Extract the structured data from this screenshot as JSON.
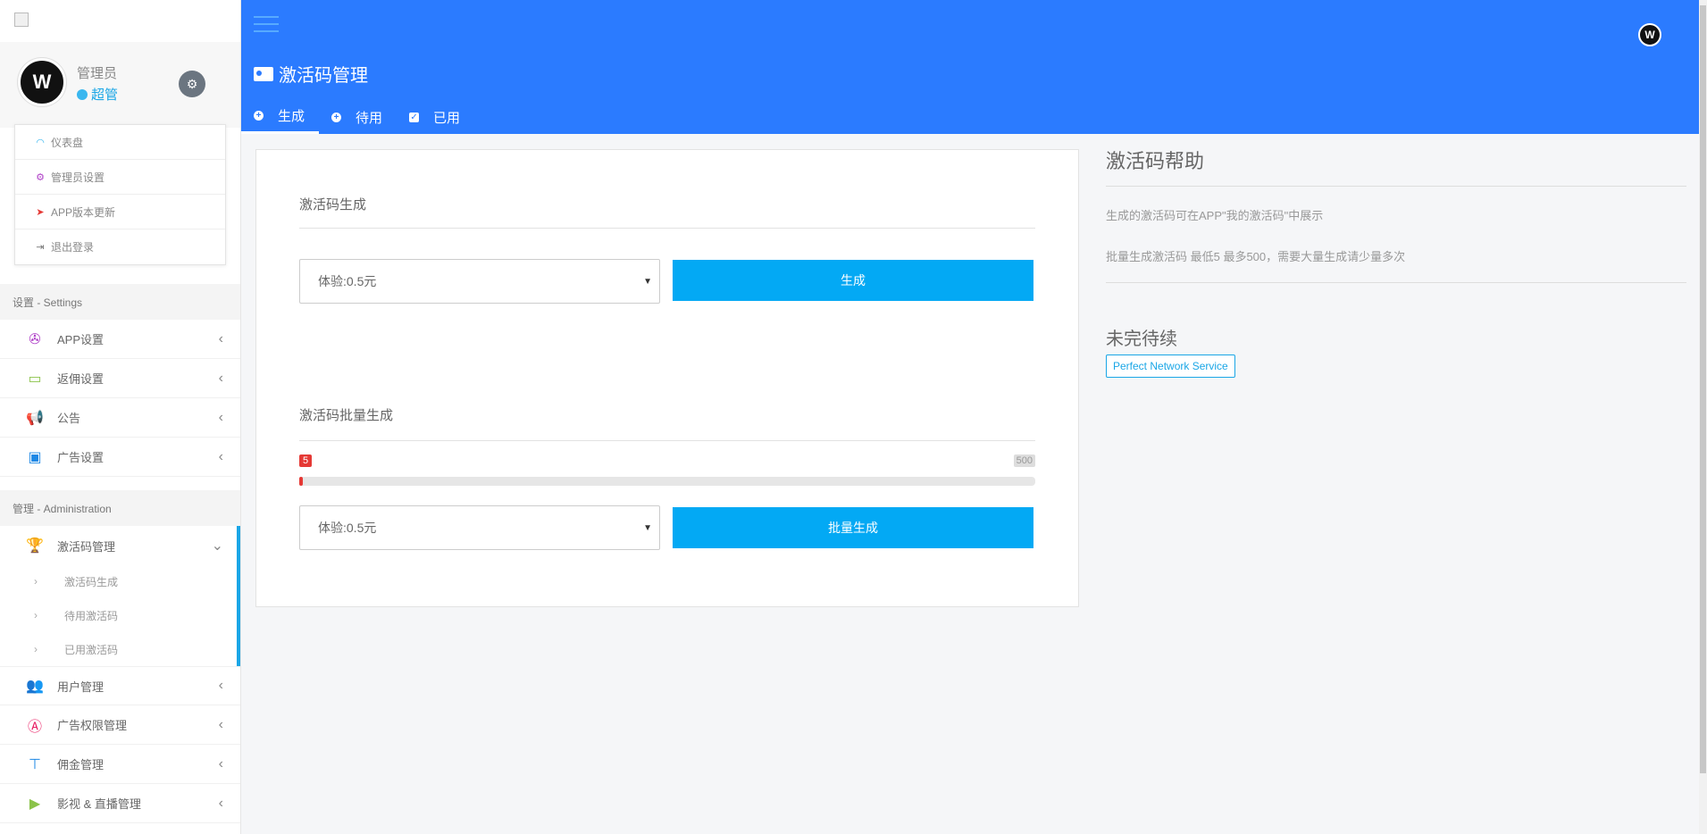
{
  "header": {
    "page_title": "激活码管理",
    "tabs": [
      {
        "label": "生成",
        "icon": "plus-circle-icon",
        "active": true
      },
      {
        "label": "待用",
        "icon": "plus-circle-icon",
        "active": false
      },
      {
        "label": "已用",
        "icon": "check-square-icon",
        "active": false
      }
    ],
    "accent_color": "#2b7bff"
  },
  "profile": {
    "name": "管理员",
    "role": "超管"
  },
  "user_menu": [
    {
      "label": "仪表盘",
      "icon": "dashboard-icon"
    },
    {
      "label": "管理员设置",
      "icon": "gears-icon"
    },
    {
      "label": "APP版本更新",
      "icon": "paper-plane-icon"
    },
    {
      "label": "退出登录",
      "icon": "sign-out-icon"
    }
  ],
  "sidebar": {
    "settings_header": "设置 - Settings",
    "settings_items": [
      {
        "label": "APP设置",
        "icon": "android-icon"
      },
      {
        "label": "返佣设置",
        "icon": "credit-card-icon"
      },
      {
        "label": "公告",
        "icon": "bullhorn-icon"
      },
      {
        "label": "广告设置",
        "icon": "image-icon"
      }
    ],
    "admin_header": "管理 - Administration",
    "admin_active": {
      "label": "激活码管理",
      "icon": "trophy-icon"
    },
    "admin_subitems": [
      {
        "label": "激活码生成"
      },
      {
        "label": "待用激活码"
      },
      {
        "label": "已用激活码"
      }
    ],
    "admin_items": [
      {
        "label": "用户管理",
        "icon": "users-icon"
      },
      {
        "label": "广告权限管理",
        "icon": "angular-icon"
      },
      {
        "label": "佣金管理",
        "icon": "sitemap-icon"
      },
      {
        "label": "影视 & 直播管理",
        "icon": "play-icon"
      }
    ]
  },
  "generate": {
    "section_title": "激活码生成",
    "select_value": "体验:0.5元",
    "button_label": "生成"
  },
  "batch": {
    "section_title": "激活码批量生成",
    "slider_min": "5",
    "slider_max": "500",
    "select_value": "体验:0.5元",
    "button_label": "批量生成"
  },
  "help": {
    "title": "激活码帮助",
    "line1": "生成的激活码可在APP\"我的激活码\"中展示",
    "line2": "批量生成激活码 最低5 最多500，需要大量生成请少量多次",
    "title2": "未完待续",
    "tag": "Perfect Network Service"
  }
}
